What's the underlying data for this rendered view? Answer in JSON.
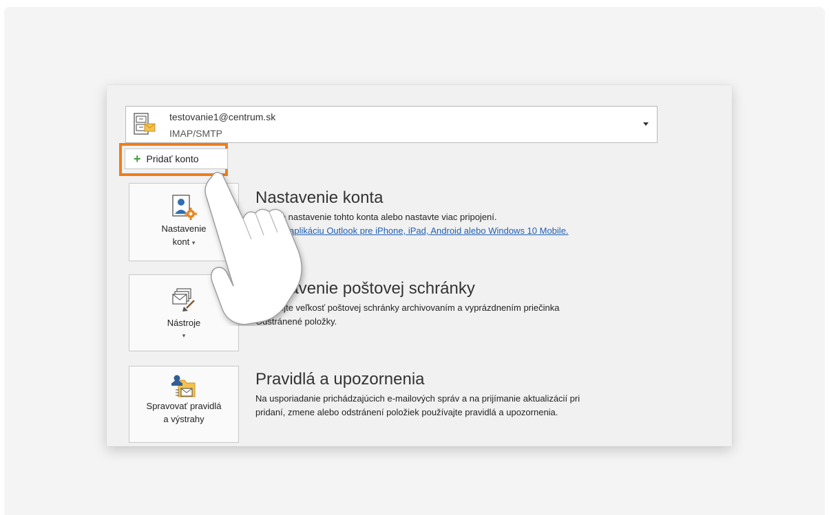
{
  "account": {
    "email": "testovanie1@centrum.sk",
    "type": "IMAP/SMTP",
    "icon": "mailbox-icon"
  },
  "add_account": {
    "label": "Pridať konto",
    "icon": "plus-icon",
    "icon_color": "#3f9b3b",
    "highlight_color": "#f07d1a"
  },
  "sections": [
    {
      "tile_label_line1": "Nastavenie",
      "tile_label_line2": "kont",
      "icon": "account-settings-icon",
      "title": "Nastavenie konta",
      "description": "Zmeňte nastavenie tohto konta alebo nastavte viac pripojení.",
      "link": "Získajte aplikáciu Outlook pre iPhone, iPad, Android alebo Windows 10 Mobile."
    },
    {
      "tile_label_line1": "Nástroje",
      "icon": "mailbox-cleanup-icon",
      "title": "Nastavenie poštovej schránky",
      "description_line1": "Spravujte veľkosť poštovej schránky archivovaním a vyprázdnením priečinka",
      "description_line2": "Odstránené položky."
    },
    {
      "tile_label_line1": "Spravovať pravidlá",
      "tile_label_line2": "a výstrahy",
      "icon": "rules-alerts-icon",
      "title": "Pravidlá a upozornenia",
      "description_line1": "Na usporiadanie prichádzajúcich e-mailových správ a na prijímanie aktualizácií pri",
      "description_line2": "pridaní, zmene alebo odstránení položiek používajte pravidlá a upozornenia."
    }
  ],
  "overlay": {
    "icon": "pointing-hand-icon"
  },
  "colors": {
    "link": "#1e5fb3",
    "panel_bg": "#f1f1f1"
  }
}
